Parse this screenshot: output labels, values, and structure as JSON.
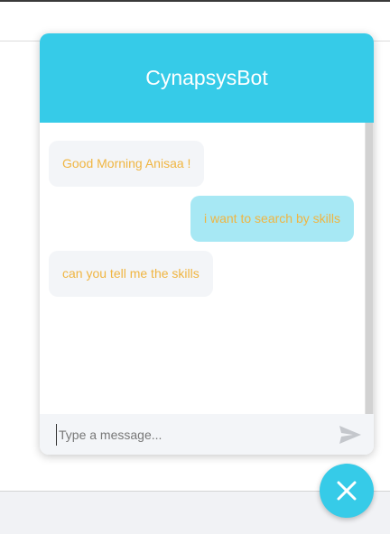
{
  "chat": {
    "title": "CynapsysBot",
    "messages": [
      {
        "sender": "bot",
        "text": "Good Morning Anisaa !"
      },
      {
        "sender": "user",
        "text": "i want to search by skills"
      },
      {
        "sender": "bot",
        "text": "can you tell me the skills"
      }
    ],
    "input": {
      "placeholder": "Type a message...",
      "value": ""
    },
    "send_icon": "send-icon",
    "close_icon": "close-icon"
  },
  "colors": {
    "accent": "#36cbe8",
    "message_text": "#f0b541",
    "bot_bubble": "#f3f5f8",
    "user_bubble": "#a7e8f4"
  }
}
